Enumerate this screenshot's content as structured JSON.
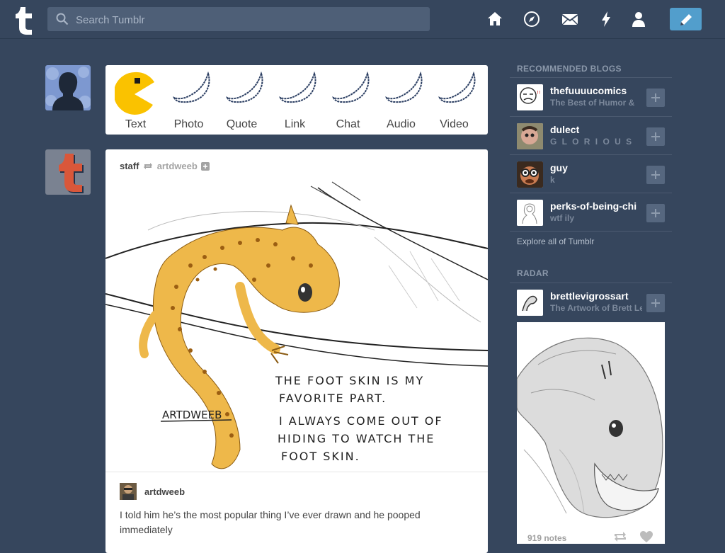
{
  "header": {
    "search_placeholder": "Search Tumblr",
    "icons": [
      "home-icon",
      "explore-icon",
      "inbox-icon",
      "activity-icon",
      "account-icon"
    ],
    "compose_icon": "pencil-icon",
    "accent": "#529ecc",
    "background": "#36465d"
  },
  "post_types": [
    {
      "label": "Text",
      "icon": "pacman-icon"
    },
    {
      "label": "Photo",
      "icon": "banana-icon"
    },
    {
      "label": "Quote",
      "icon": "banana-icon"
    },
    {
      "label": "Link",
      "icon": "banana-icon"
    },
    {
      "label": "Chat",
      "icon": "banana-icon"
    },
    {
      "label": "Audio",
      "icon": "banana-icon"
    },
    {
      "label": "Video",
      "icon": "banana-icon"
    }
  ],
  "post": {
    "author": "staff",
    "reblogged_from": "artdweeb",
    "image_text": {
      "signature": "ARTDWEEB",
      "lines": [
        "THE FOOT SKIN IS MY",
        "FAVORITE PART.",
        "I ALWAYS COME OUT OF",
        "HIDING TO WATCH THE",
        "FOOT SKIN."
      ]
    },
    "reblog_author": "artdweeb",
    "caption": "I told him he’s the most popular thing I’ve ever drawn and he pooped immediately"
  },
  "sidebar": {
    "recommended_title": "RECOMMENDED BLOGS",
    "blogs": [
      {
        "name": "thefuuuucomics",
        "sub": "The Best of Humor &"
      },
      {
        "name": "dulect",
        "sub": "G L O R I O U S"
      },
      {
        "name": "guy",
        "sub": "k"
      },
      {
        "name": "perks-of-being-chi",
        "sub": "wtf ily"
      }
    ],
    "explore_link": "Explore all of Tumblr",
    "radar_title": "RADAR",
    "radar": {
      "name": "brettlevigrossart",
      "sub": "The Artwork of Brett Le",
      "notes": "919 notes"
    }
  }
}
